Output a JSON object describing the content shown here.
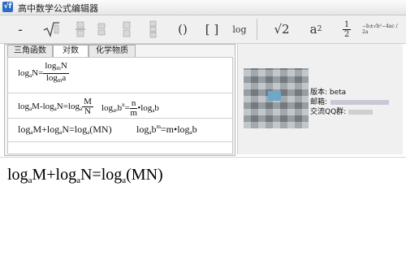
{
  "window": {
    "title": "高中数学公式编辑器",
    "icon": "app-logo-icon"
  },
  "toolbar": {
    "buttons": [
      {
        "name": "minus-button",
        "label": "-"
      },
      {
        "name": "sqrt-button",
        "label": "√"
      },
      {
        "name": "fraction-template-button",
        "label": ""
      },
      {
        "name": "fraction-template-2-button",
        "label": ""
      },
      {
        "name": "matrix-template-button",
        "label": ""
      },
      {
        "name": "parentheses-button",
        "label": "()"
      },
      {
        "name": "brackets-button",
        "label": "[ ]"
      },
      {
        "name": "log-button",
        "label": "log"
      },
      {
        "name": "sqrt2-button",
        "label": "√2"
      },
      {
        "name": "a-squared-button",
        "label": "a",
        "sup": "2"
      },
      {
        "name": "half-button",
        "num": "1",
        "den": "2"
      },
      {
        "name": "quadratic-formula-button",
        "label": "−b±√b²−4ac / 2a"
      }
    ]
  },
  "tabs": [
    "三角函数",
    "对数",
    "化学物质"
  ],
  "active_tab": 1,
  "formulas": {
    "f1": {
      "log": "log",
      "a": "a",
      "N": "N",
      "m": "m"
    },
    "f2a": {
      "text": "log",
      "sub_a": "a",
      "mid": "M-log",
      "sub_a2": "a",
      "eq": "N=log",
      "sub_a3": "a",
      "num": "M",
      "den": "N"
    },
    "f2b": {
      "log": "log",
      "sub": "a",
      "sub2": "b",
      "pow": "n",
      "eq": "=",
      "num": "n",
      "den": "m",
      "dot": "•log",
      "sub3": "a",
      "b": "b"
    },
    "f3a": {
      "text": "log",
      "sub_a": "a",
      "mid": "M+log",
      "sub_a2": "a",
      "eq": "N=log",
      "sub_a3": "a",
      "tail": "(MN)"
    },
    "f3b": {
      "log": "log",
      "sub": "a",
      "b": "b",
      "sup": "m",
      "eq": "=m•log",
      "sub2": "a",
      "b2": "b"
    }
  },
  "info_panel": {
    "version": "版本: beta",
    "email": "邮箱:",
    "qq": "交流QQ群:"
  },
  "editor": {
    "expr_log1": "log",
    "expr_a1": "a",
    "expr_mid": "M+log",
    "expr_a2": "a",
    "expr_eq": "N=log",
    "expr_a3": "a",
    "expr_tail": "(MN)"
  }
}
